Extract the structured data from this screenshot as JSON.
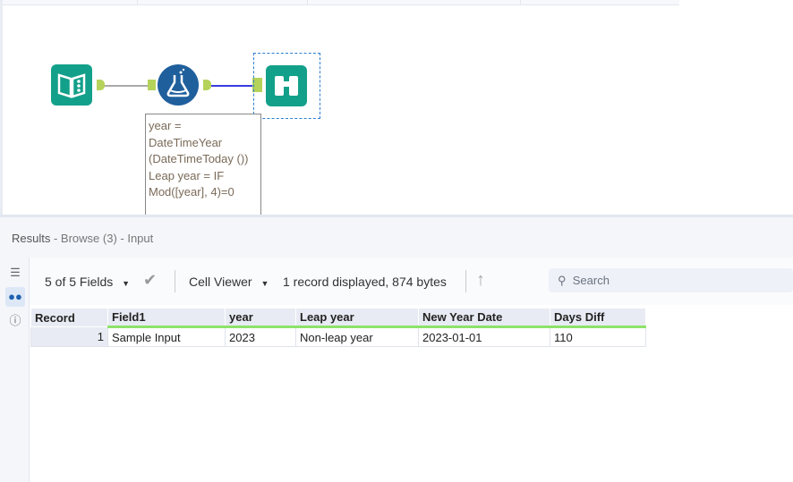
{
  "canvas": {
    "tools": [
      {
        "name": "text-input-tool",
        "color": "#13a08a"
      },
      {
        "name": "formula-tool",
        "color": "#1f5f9c"
      },
      {
        "name": "browse-tool",
        "color": "#13a08a"
      }
    ],
    "annotation": "year = DateTimeYear (DateTimeToday ()) Leap year = IF Mod([year], 4)=0"
  },
  "results": {
    "title": "Results",
    "subtitle": "- Browse (3) - Input",
    "toolbar": {
      "fields": "5 of 5 Fields",
      "viewer": "Cell Viewer",
      "status": "1 record displayed, 874 bytes",
      "search_placeholder": "Search"
    },
    "columns": [
      "Record",
      "Field1",
      "year",
      "Leap year",
      "New Year Date",
      "Days Diff"
    ],
    "rows": [
      [
        "1",
        "Sample Input",
        "2023",
        "Non-leap year",
        "2023-01-01",
        "110"
      ]
    ]
  }
}
